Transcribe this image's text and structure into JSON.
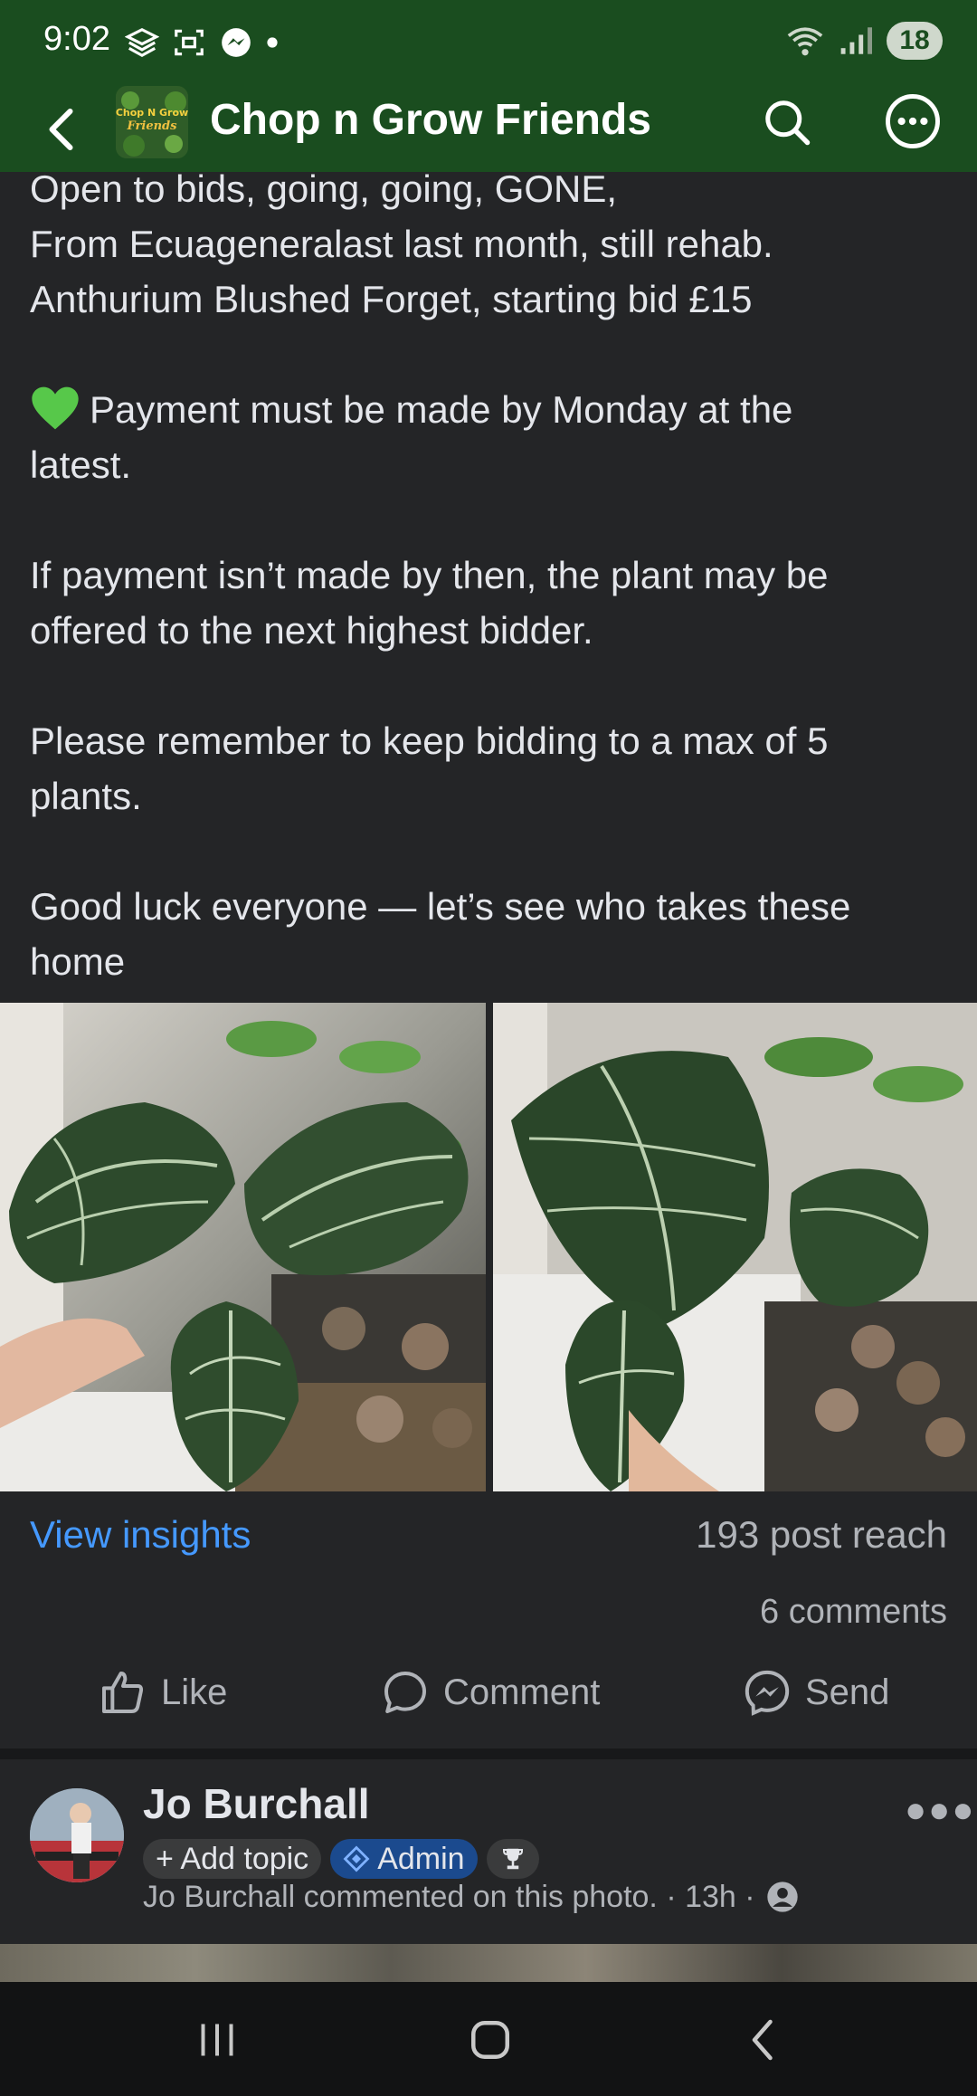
{
  "status_bar": {
    "time": "9:02",
    "battery": "18"
  },
  "header": {
    "group_name": "Chop n Grow Friends",
    "logo_text_top": "Chop N Grow",
    "logo_text_bottom": "Friends"
  },
  "post": {
    "lines": [
      "Open to bids, going, going, GONE,",
      "From Ecuageneralast last month, still rehab.",
      "Anthurium Blushed Forget, starting bid £15",
      "",
      "Payment must be made by Monday at the",
      "latest.",
      "",
      "If payment isn’t made by then, the plant may be",
      "offered to the next highest bidder.",
      "",
      "Please remember to keep bidding to a max of 5",
      "plants.",
      "",
      "Good luck everyone — let’s see who takes these",
      "home"
    ]
  },
  "insights": {
    "link": "View insights",
    "reach": "193 post reach",
    "comments": "6 comments"
  },
  "actions": {
    "like": "Like",
    "comment": "Comment",
    "send": "Send"
  },
  "comment": {
    "author": "Jo Burchall",
    "add_topic": "+ Add topic",
    "admin_badge": "Admin",
    "meta": "Jo Burchall commented on this photo. · 13h ·"
  },
  "colors": {
    "header_bg": "#1a4d1f",
    "page_bg": "#242527",
    "link": "#4599ff",
    "admin_chip": "#1b4a8e"
  }
}
